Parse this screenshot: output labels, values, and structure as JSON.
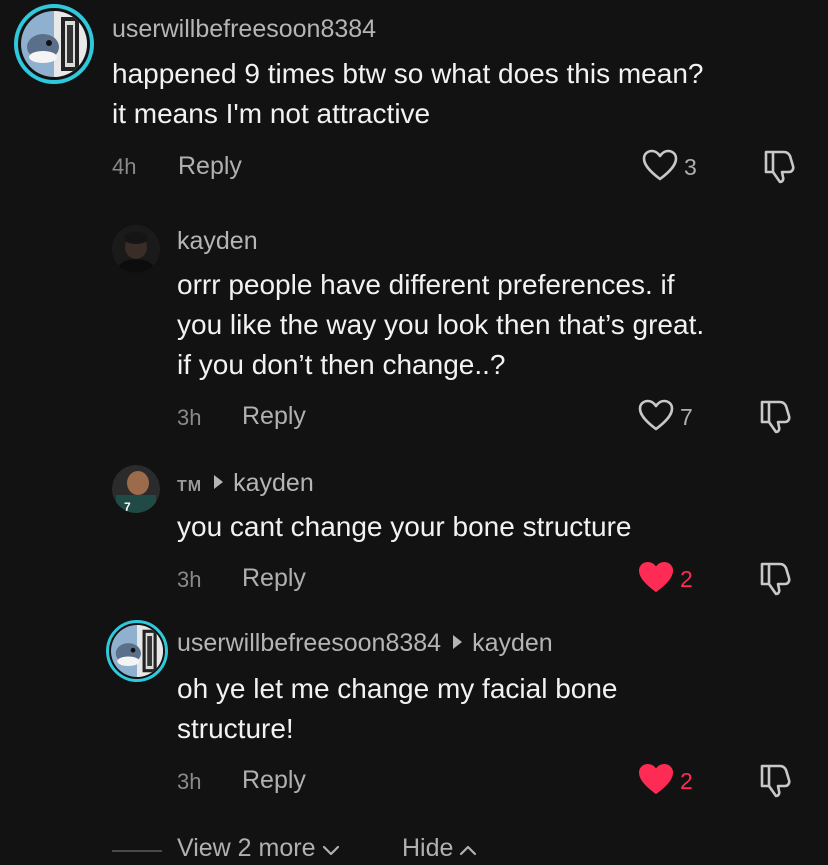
{
  "comments": [
    {
      "username": "userwillbefreesoon8384",
      "text_lines": [
        "happened 9 times btw so what does this mean?",
        "it means I'm not attractive"
      ],
      "time": "4h",
      "reply_label": "Reply",
      "likes": "3",
      "liked": false
    },
    {
      "username": "kayden",
      "text_lines": [
        "orrr people have different preferences. if",
        "you like the way you look then that’s great.",
        "if you don’t then change..?"
      ],
      "time": "3h",
      "reply_label": "Reply",
      "likes": "7",
      "liked": false
    },
    {
      "username": "TM",
      "reply_to": "kayden",
      "text_lines": [
        "you cant change your bone structure"
      ],
      "time": "3h",
      "reply_label": "Reply",
      "likes": "2",
      "liked": true
    },
    {
      "username": "userwillbefreesoon8384",
      "reply_to": "kayden",
      "text_lines": [
        "oh ye let me change my facial bone",
        "structure!"
      ],
      "time": "3h",
      "reply_label": "Reply",
      "likes": "2",
      "liked": true
    }
  ],
  "footer": {
    "view_more_label": "View 2 more",
    "hide_label": "Hide"
  },
  "colors": {
    "background": "#121212",
    "ring": "#2ec9dc",
    "liked": "#fe2c55",
    "muted": "#b0b0b0"
  },
  "icons": {
    "like": "heart-outline-icon",
    "liked": "heart-filled-icon",
    "dislike": "thumbs-down-icon",
    "chevron_down": "chevron-down-icon",
    "chevron_up": "chevron-up-icon",
    "reply_to_arrow": "caret-right-icon"
  }
}
